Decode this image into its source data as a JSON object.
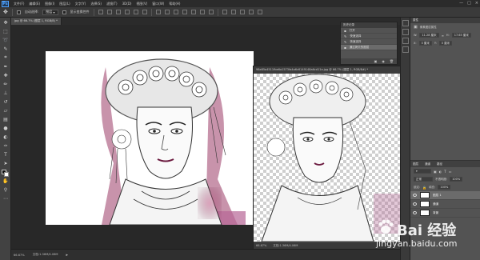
{
  "app": {
    "logo": "Ps",
    "menu": [
      "文件(F)",
      "编辑(E)",
      "图像(I)",
      "图层(L)",
      "文字(Y)",
      "选择(S)",
      "滤镜(T)",
      "3D(D)",
      "视图(V)",
      "窗口(W)",
      "帮助(H)"
    ],
    "window_controls": [
      "—",
      "□",
      "×"
    ]
  },
  "options_bar": {
    "auto_select_label": "自动选择:",
    "auto_select_value": "图层",
    "show_transform_label": "显示变换控件"
  },
  "tabs": [
    {
      "label": "jpg @ 66.7% (图层 1, RGB/8) *",
      "active": true
    }
  ],
  "document_window": {
    "title": "98e85a4511fbe6a1573fa4a6c6149148a6cd11a.jpg @ 66.7% (图层 1, RGB/8#) *",
    "close": "×",
    "zoom": "66.67%",
    "doc_info": "文档:1.36M/4.06M"
  },
  "status_bar": {
    "zoom": "66.67%",
    "doc_info": "文档:1.36M/4.06M"
  },
  "history_panel": {
    "title": "历史记录",
    "items": [
      {
        "label": "打开",
        "selected": false
      },
      {
        "label": "快速选择",
        "selected": false
      },
      {
        "label": "快速选择",
        "selected": false
      },
      {
        "label": "通过拷贝的图层",
        "selected": true
      }
    ]
  },
  "properties_panel": {
    "title": "属性",
    "subtitle": "像素图层属性",
    "w_label": "W:",
    "w_value": "11.28 厘米",
    "h_label": "H:",
    "h_value": "17.65 厘米",
    "x_label": "X:",
    "x_value": "0 厘米",
    "y_label": "Y:",
    "y_value": "0 厘米"
  },
  "layers_panel": {
    "tabs": [
      "图层",
      "通道",
      "路径"
    ],
    "mode": "正常",
    "opacity_label": "不透明度:",
    "opacity_value": "100%",
    "lock_label": "锁定:",
    "fill_label": "填充:",
    "fill_value": "100%",
    "layers": [
      {
        "name": "图层 1",
        "selected": true
      },
      {
        "name": "通道",
        "selected": false
      },
      {
        "name": "背景",
        "selected": false
      }
    ]
  },
  "watermark": {
    "main": "Bai 经验",
    "sub": "jingyan.baidu.com"
  },
  "colors": {
    "fg": "#111111",
    "bg": "#ffffff",
    "accent": "#4fa3ff"
  }
}
